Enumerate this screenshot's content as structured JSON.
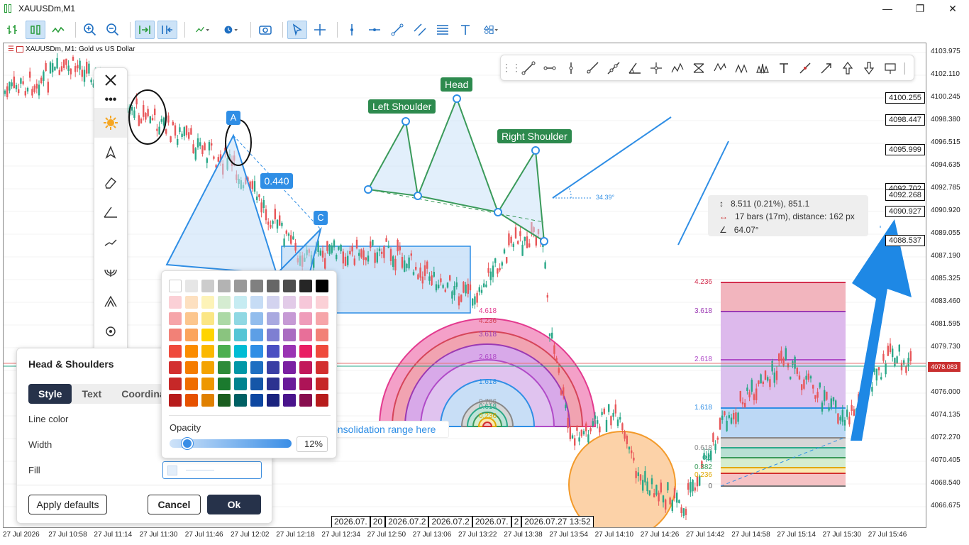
{
  "window": {
    "title": "XAUUSDm,M1",
    "buttons": [
      "—",
      "❐",
      "✕"
    ]
  },
  "symbol": {
    "label": "XAUUSDm, M1:  Gold vs US Dollar"
  },
  "price_scale": [
    "4103.975",
    "4102.110",
    "4100.245",
    "4098.380",
    "4096.515",
    "4094.635",
    "4092.785",
    "4090.920",
    "4089.055",
    "4087.190",
    "4085.325",
    "4083.460",
    "4081.595",
    "4079.730",
    "4077.865",
    "4076.000",
    "4074.135",
    "4072.270",
    "4070.405",
    "4068.540",
    "4066.675"
  ],
  "price_boxes": [
    "4100.255",
    "4098.447",
    "4095.999",
    "4092.268",
    "4090.927",
    "4088.537"
  ],
  "price_box_clipped": "4092.702",
  "current_price": "4078.083",
  "time_scale": [
    "27 Jul 2026",
    "27 Jul 10:58",
    "27 Jul 11:14",
    "27 Jul 11:30",
    "27 Jul 11:46",
    "27 Jul 12:02",
    "27 Jul 12:18",
    "27 Jul 12:34",
    "27 Jul 12:50",
    "27 Jul 13:06",
    "27 Jul 13:22",
    "27 Jul 13:38",
    "27 Jul 13:54",
    "27 Jul 14:10",
    "27 Jul 14:26",
    "27 Jul 14:42",
    "27 Jul 14:58",
    "27 Jul 15:14",
    "27 Jul 15:30",
    "27 Jul 15:46"
  ],
  "time_labels": [
    "2026.07.",
    "20",
    "2026.07.2",
    "2026.07.2",
    "2026.07.",
    "2",
    "2026.07.27 13:52"
  ],
  "pattern": {
    "left_shoulder": "Left Shoulder",
    "head": "Head",
    "right_shoulder": "Right Shoulder",
    "angle": "34.39°"
  },
  "abc": {
    "a": "A",
    "c": "C",
    "ratio": "0.440"
  },
  "consolidation": "Consolidation range here",
  "measure": {
    "row1": "8.511 (0.21%), 851.1",
    "row2": "17 bars (17m), distance: 162 px",
    "row3": "64.07°"
  },
  "fib_right": [
    "4.236",
    "3.618",
    "2.618",
    "1.618",
    "0.618",
    "0.5",
    "0.382",
    "0.236",
    "0"
  ],
  "fib_arcs": [
    "4.618",
    "4.236",
    "3.618",
    "2.618",
    "1.618",
    "0.786",
    "0.618",
    "0.236"
  ],
  "dialog": {
    "title": "Head & Shoulders",
    "tabs": [
      "Style",
      "Text",
      "Coordinates"
    ],
    "line_color": "Line color",
    "width": "Width",
    "fill": "Fill",
    "apply_defaults": "Apply defaults",
    "cancel": "Cancel",
    "ok": "Ok"
  },
  "palette": {
    "opacity_label": "Opacity",
    "opacity_value": "12%",
    "opacity_fraction": 0.12,
    "colors": [
      [
        "#ffffff",
        "#e6e6e6",
        "#cccccc",
        "#b3b3b3",
        "#999999",
        "#808080",
        "#666666",
        "#4d4d4d",
        "#262626",
        "#000000"
      ],
      [
        "#fbd0d6",
        "#fde0c0",
        "#fdf3b8",
        "#d5ecd1",
        "#c6ecf2",
        "#c6dcf5",
        "#d3d3ef",
        "#e2cbe8",
        "#f6c7d9",
        "#fbd0d6"
      ],
      [
        "#f6a5a9",
        "#fcc68e",
        "#fbe685",
        "#acd9a6",
        "#8fd8e3",
        "#92bded",
        "#a9a9e0",
        "#c69ad5",
        "#ef9cba",
        "#f6a5a9"
      ],
      [
        "#f28177",
        "#fba45c",
        "#ffd400",
        "#8ac47f",
        "#54c5d5",
        "#5d9fe6",
        "#7e7fd2",
        "#aa6cc1",
        "#e86f99",
        "#f28177"
      ],
      [
        "#ef4a3c",
        "#fb8c00",
        "#fbb800",
        "#4caf50",
        "#00bcd4",
        "#2f8ee5",
        "#4a4fc2",
        "#9a34b3",
        "#e91e63",
        "#ef4a3c"
      ],
      [
        "#d32f2f",
        "#f57c00",
        "#f4a300",
        "#2e8b3a",
        "#0097a7",
        "#1e6fc2",
        "#3a3fa4",
        "#7b1fa2",
        "#c2185b",
        "#d32f2f"
      ],
      [
        "#c62828",
        "#ef6c00",
        "#ee9700",
        "#1b7a2e",
        "#00838f",
        "#1556a8",
        "#2c3290",
        "#6a1b9a",
        "#ad1457",
        "#c62828"
      ],
      [
        "#b71c1c",
        "#e65100",
        "#e08000",
        "#1b5e20",
        "#006064",
        "#0d47a1",
        "#1a237e",
        "#4a148c",
        "#880e4f",
        "#b71c1c"
      ]
    ]
  },
  "colors": {
    "accent": "#2f8ee5",
    "green": "#2d8a4e",
    "dark": "#26324a",
    "bull": "#2aa888",
    "bear": "#e8575a"
  }
}
